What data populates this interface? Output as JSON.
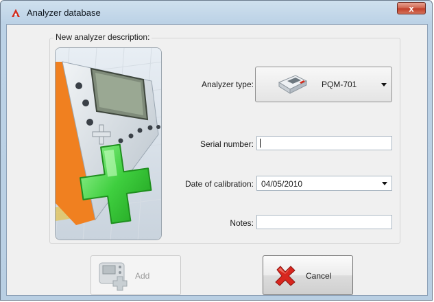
{
  "window": {
    "title": "Analyzer database",
    "close_glyph": "x"
  },
  "form": {
    "group_label": "New analyzer description:",
    "analyzer_type_label": "Analyzer type:",
    "analyzer_type_value": "PQM-701",
    "serial_label": "Serial number:",
    "serial_value": "",
    "calibration_label": "Date of calibration:",
    "calibration_value": "04/05/2010",
    "notes_label": "Notes:",
    "notes_value": ""
  },
  "buttons": {
    "add_label": "Add",
    "cancel_label": "Cancel"
  },
  "icons": {
    "app": "app-logo-icon",
    "close": "close-icon",
    "analyzer": "analyzer-device-icon",
    "add": "add-device-icon",
    "cancel": "red-x-icon",
    "illustration": "new-analyzer-illustration"
  },
  "colors": {
    "accent_green": "#3fcf3f",
    "cancel_red": "#d8261e",
    "device_orange": "#f08020"
  }
}
